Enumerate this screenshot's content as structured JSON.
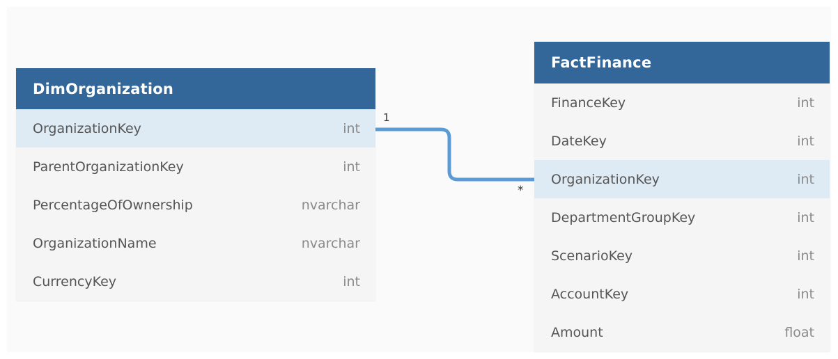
{
  "tables": {
    "dim_organization": {
      "title": "DimOrganization",
      "columns": [
        {
          "name": "OrganizationKey",
          "type": "int",
          "highlighted": true
        },
        {
          "name": "ParentOrganizationKey",
          "type": "int",
          "highlighted": false
        },
        {
          "name": "PercentageOfOwnership",
          "type": "nvarchar",
          "highlighted": false
        },
        {
          "name": "OrganizationName",
          "type": "nvarchar",
          "highlighted": false
        },
        {
          "name": "CurrencyKey",
          "type": "int",
          "highlighted": false
        }
      ]
    },
    "fact_finance": {
      "title": "FactFinance",
      "columns": [
        {
          "name": "FinanceKey",
          "type": "int",
          "highlighted": false
        },
        {
          "name": "DateKey",
          "type": "int",
          "highlighted": false
        },
        {
          "name": "OrganizationKey",
          "type": "int",
          "highlighted": true
        },
        {
          "name": "DepartmentGroupKey",
          "type": "int",
          "highlighted": false
        },
        {
          "name": "ScenarioKey",
          "type": "int",
          "highlighted": false
        },
        {
          "name": "AccountKey",
          "type": "int",
          "highlighted": false
        },
        {
          "name": "Amount",
          "type": "float",
          "highlighted": false
        }
      ]
    }
  },
  "relationship": {
    "from_table": "DimOrganization",
    "from_column": "OrganizationKey",
    "to_table": "FactFinance",
    "to_column": "OrganizationKey",
    "from_cardinality": "1",
    "to_cardinality": "*"
  },
  "colors": {
    "header": "#336699",
    "highlight_row": "#deebf4",
    "relationship_line": "#5b9bd5"
  }
}
